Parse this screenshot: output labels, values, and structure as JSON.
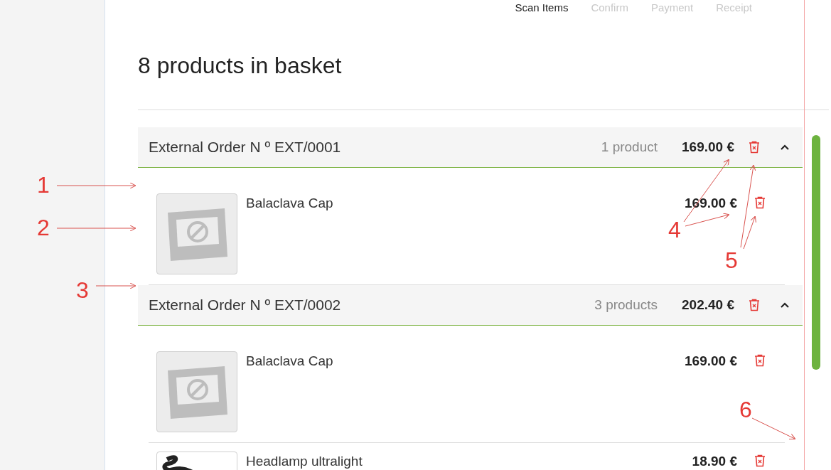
{
  "steps": [
    {
      "label": "Scan Items",
      "selected": true
    },
    {
      "label": "Confirm",
      "selected": false
    },
    {
      "label": "Payment",
      "selected": false
    },
    {
      "label": "Receipt",
      "selected": false
    }
  ],
  "basket_title": "8 products in basket",
  "orders": [
    {
      "title": "External Order N º EXT/0001",
      "count": "1 product",
      "total": "169.00 €",
      "expanded": true,
      "items": [
        {
          "name": "Balaclava Cap",
          "price": "169.00 €",
          "kind": "placeholder"
        }
      ]
    },
    {
      "title": "External Order N º EXT/0002",
      "count": "3 products",
      "total": "202.40 €",
      "expanded": true,
      "items": [
        {
          "name": "Balaclava Cap",
          "price": "169.00 €",
          "kind": "placeholder"
        },
        {
          "name": "Headlamp ultralight",
          "price": "18.90 €",
          "kind": "photo"
        }
      ]
    }
  ],
  "annotations": [
    "1",
    "2",
    "3",
    "4",
    "5",
    "6"
  ]
}
